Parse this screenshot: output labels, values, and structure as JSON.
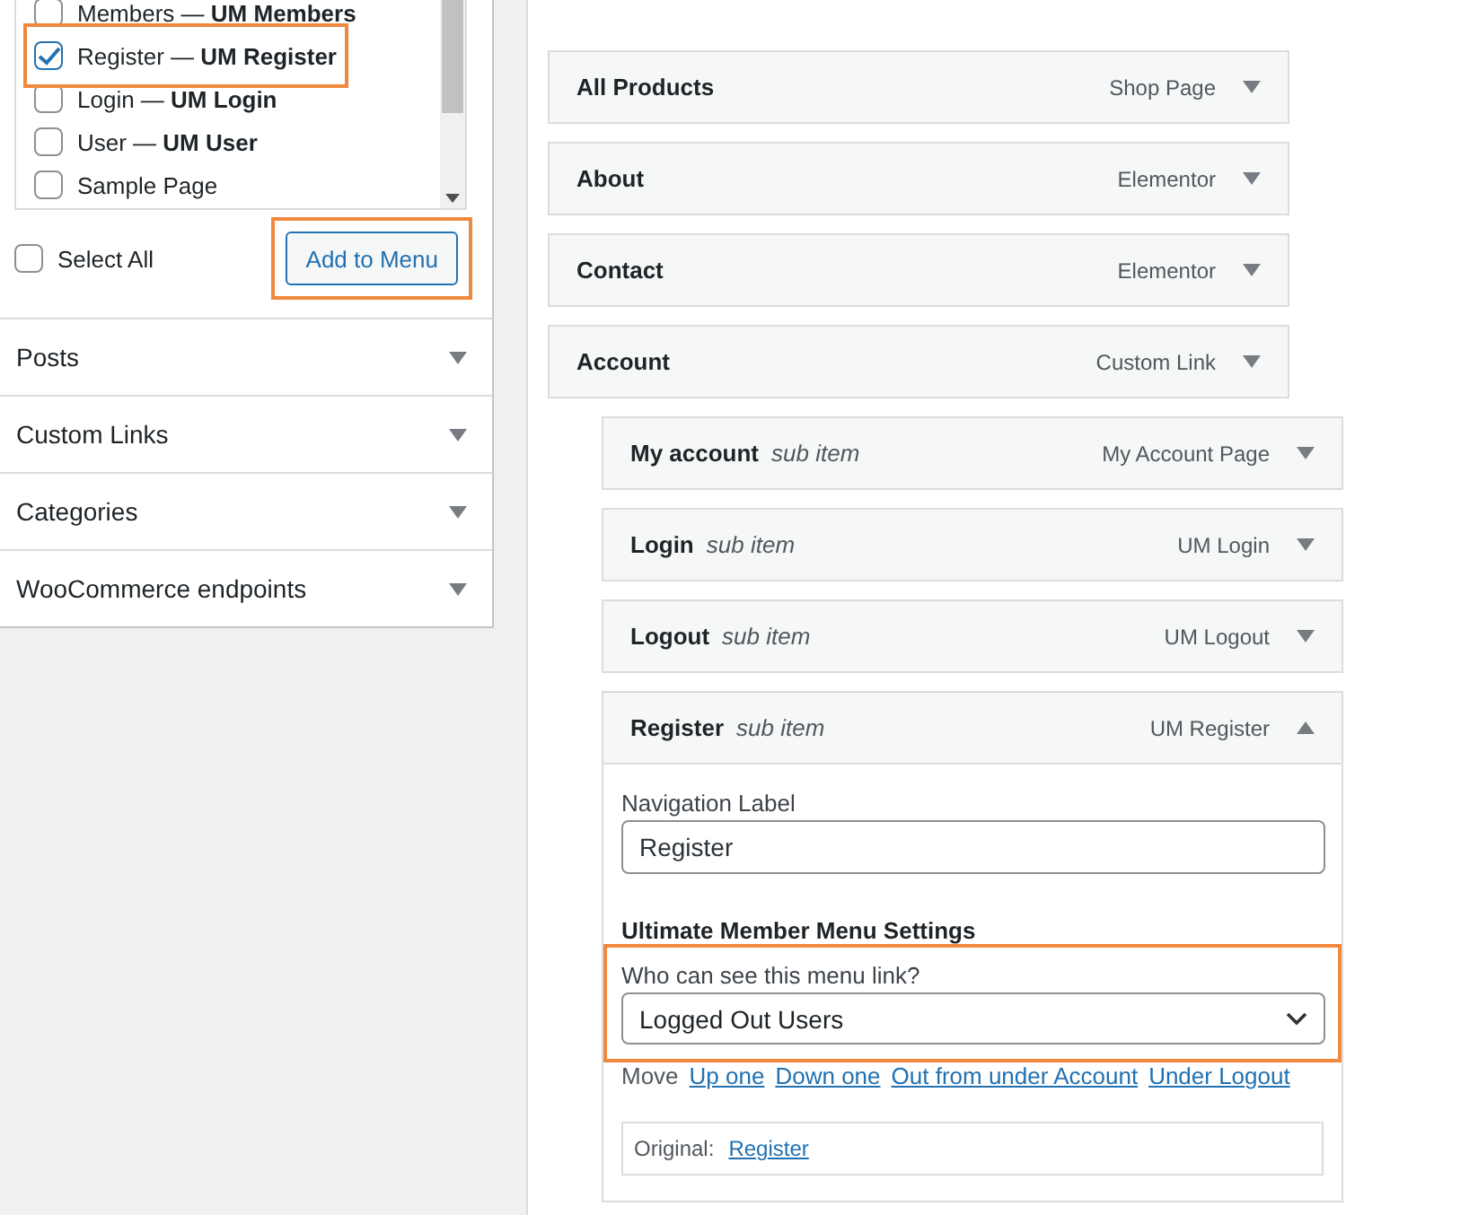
{
  "pages_box": {
    "items": [
      {
        "label": "Members — **UM Members**",
        "checked": false,
        "highlighted": false
      },
      {
        "label": "Register — **UM Register**",
        "checked": true,
        "highlighted": true
      },
      {
        "label": "Login — **UM Login**",
        "checked": false,
        "highlighted": false
      },
      {
        "label": "User — **UM User**",
        "checked": false,
        "highlighted": false
      },
      {
        "label": "Sample Page",
        "checked": false,
        "highlighted": false
      }
    ],
    "select_all": {
      "label": "Select All",
      "checked": false
    },
    "add_button": {
      "label": "Add to Menu",
      "highlighted": true
    }
  },
  "sections": [
    {
      "title": "Posts",
      "expanded": false
    },
    {
      "title": "Custom Links",
      "expanded": false
    },
    {
      "title": "Categories",
      "expanded": false
    },
    {
      "title": "WooCommerce endpoints",
      "expanded": false
    }
  ],
  "menu_items": [
    {
      "title": "All Products",
      "type": "Shop Page",
      "expanded": false
    },
    {
      "title": "About",
      "type": "Elementor",
      "expanded": false
    },
    {
      "title": "Contact",
      "type": "Elementor",
      "expanded": false
    },
    {
      "title": "Account",
      "type": "Custom Link",
      "expanded": false,
      "children": [
        {
          "title": "My account",
          "note": "sub item",
          "type": "My Account Page",
          "expanded": false
        },
        {
          "title": "Login",
          "note": "sub item",
          "type": "UM Login",
          "expanded": false
        },
        {
          "title": "Logout",
          "note": "sub item",
          "type": "UM Logout",
          "expanded": false
        },
        {
          "title": "Register",
          "note": "sub item",
          "type": "UM Register",
          "expanded": true,
          "settings": {
            "nav_label": {
              "caption": "Navigation Label",
              "value": "Register"
            },
            "section_title": "Ultimate Member Menu Settings",
            "visibility": {
              "label": "Who can see this menu link?",
              "value": "Logged Out Users",
              "highlighted": true
            },
            "move": {
              "label": "Move",
              "links": [
                "Up one",
                "Down one",
                "Out from under Account",
                "Under Logout"
              ]
            },
            "original": {
              "label": "Original:",
              "link": "Register"
            }
          }
        }
      ]
    }
  ]
}
